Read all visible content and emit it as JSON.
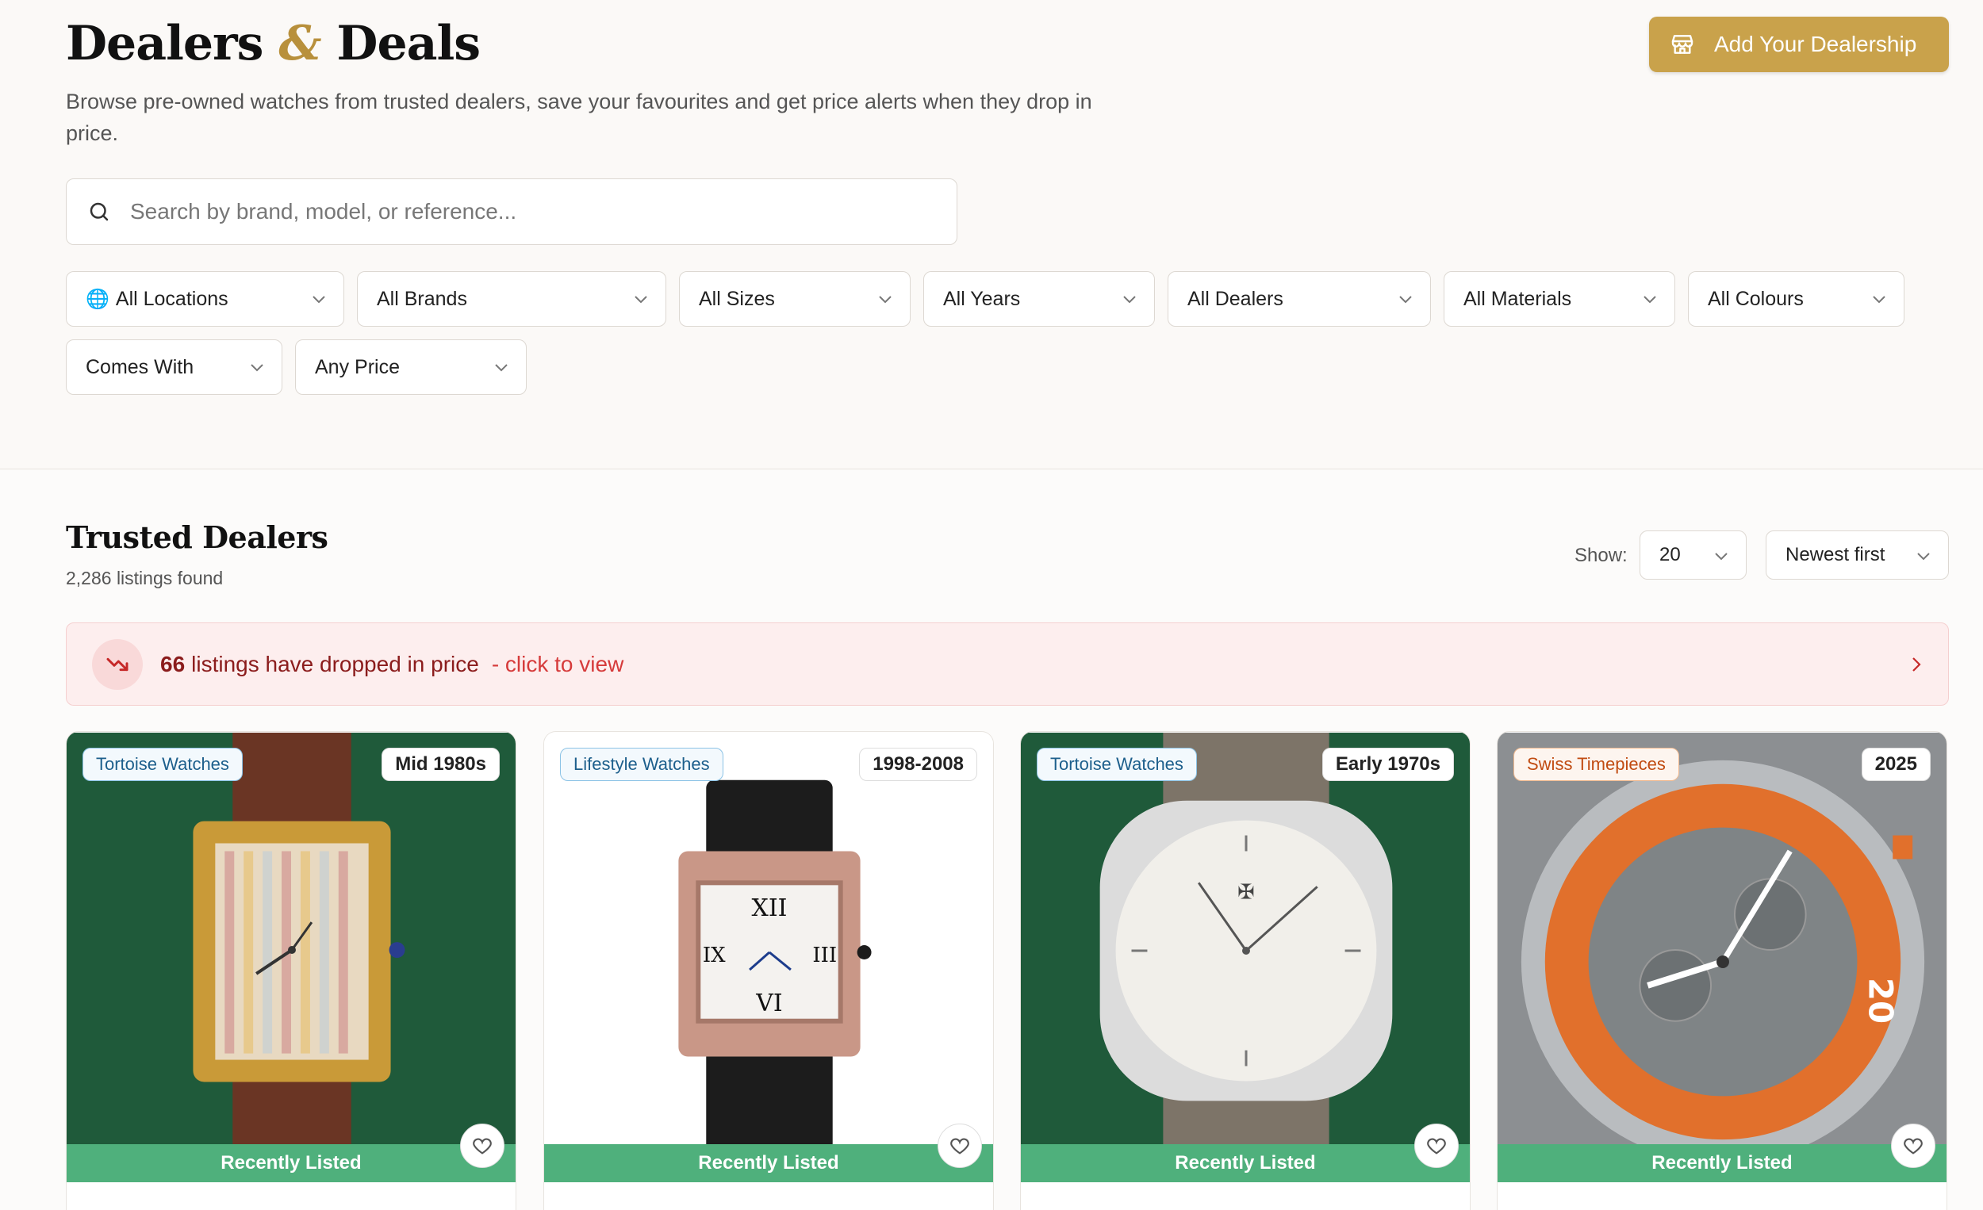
{
  "header": {
    "title_part1": "Dealers",
    "title_amp": "&",
    "title_part2": "Deals",
    "subtitle": "Browse pre-owned watches from trusted dealers, save your favourites and get price alerts when they drop in price.",
    "add_button": "Add Your Dealership"
  },
  "search": {
    "placeholder": "Search by brand, model, or reference..."
  },
  "filters": [
    {
      "label": "All Locations"
    },
    {
      "label": "All Brands"
    },
    {
      "label": "All Sizes"
    },
    {
      "label": "All Years"
    },
    {
      "label": "All Dealers"
    },
    {
      "label": "All Materials"
    },
    {
      "label": "All Colours"
    },
    {
      "label": "Comes With"
    },
    {
      "label": "Any Price"
    }
  ],
  "listings": {
    "section_title": "Trusted Dealers",
    "count": "2,286 listings found",
    "show_label": "Show:",
    "show_value": "20",
    "sort_value": "Newest first"
  },
  "price_alert": {
    "count": "66",
    "text": "listings have dropped in price",
    "link": "- click to view"
  },
  "cards": [
    {
      "dealer": "Tortoise Watches",
      "year": "Mid 1980s",
      "ribbon": "Recently Listed"
    },
    {
      "dealer": "Lifestyle Watches",
      "year": "1998-2008",
      "ribbon": "Recently Listed"
    },
    {
      "dealer": "Tortoise Watches",
      "year": "Early 1970s",
      "ribbon": "Recently Listed"
    },
    {
      "dealer": "Swiss Timepieces",
      "year": "2025",
      "ribbon": "Recently Listed"
    }
  ],
  "colors": {
    "accent": "#c9a24b",
    "ribbon": "#4fb07c",
    "alert_bg": "#fdeeee",
    "alert_text": "#8b1c1c"
  }
}
